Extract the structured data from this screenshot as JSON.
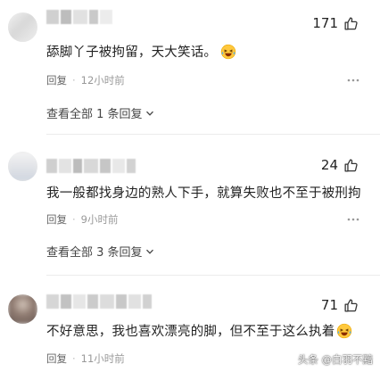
{
  "comments": [
    {
      "likes": "171",
      "text": "舔脚丫子被拘留，天大笑话。",
      "has_emoji": true,
      "reply_label": "回复",
      "time": "12小时前",
      "view_all": "查看全部 1 条回复"
    },
    {
      "likes": "24",
      "text": "我一般都找身边的熟人下手，就算失败也不至于被刑拘",
      "has_emoji": false,
      "reply_label": "回复",
      "time": "9小时前",
      "view_all": "查看全部 3 条回复"
    },
    {
      "likes": "71",
      "text": "不好意思，我也喜欢漂亮的脚，但不至于这么执着",
      "has_emoji": true,
      "reply_label": "回复",
      "time": "11小时前"
    }
  ],
  "watermark": "头条 @白羽不黯",
  "colors": {
    "text": "#222222",
    "meta": "#999999",
    "icon": "#333333"
  }
}
